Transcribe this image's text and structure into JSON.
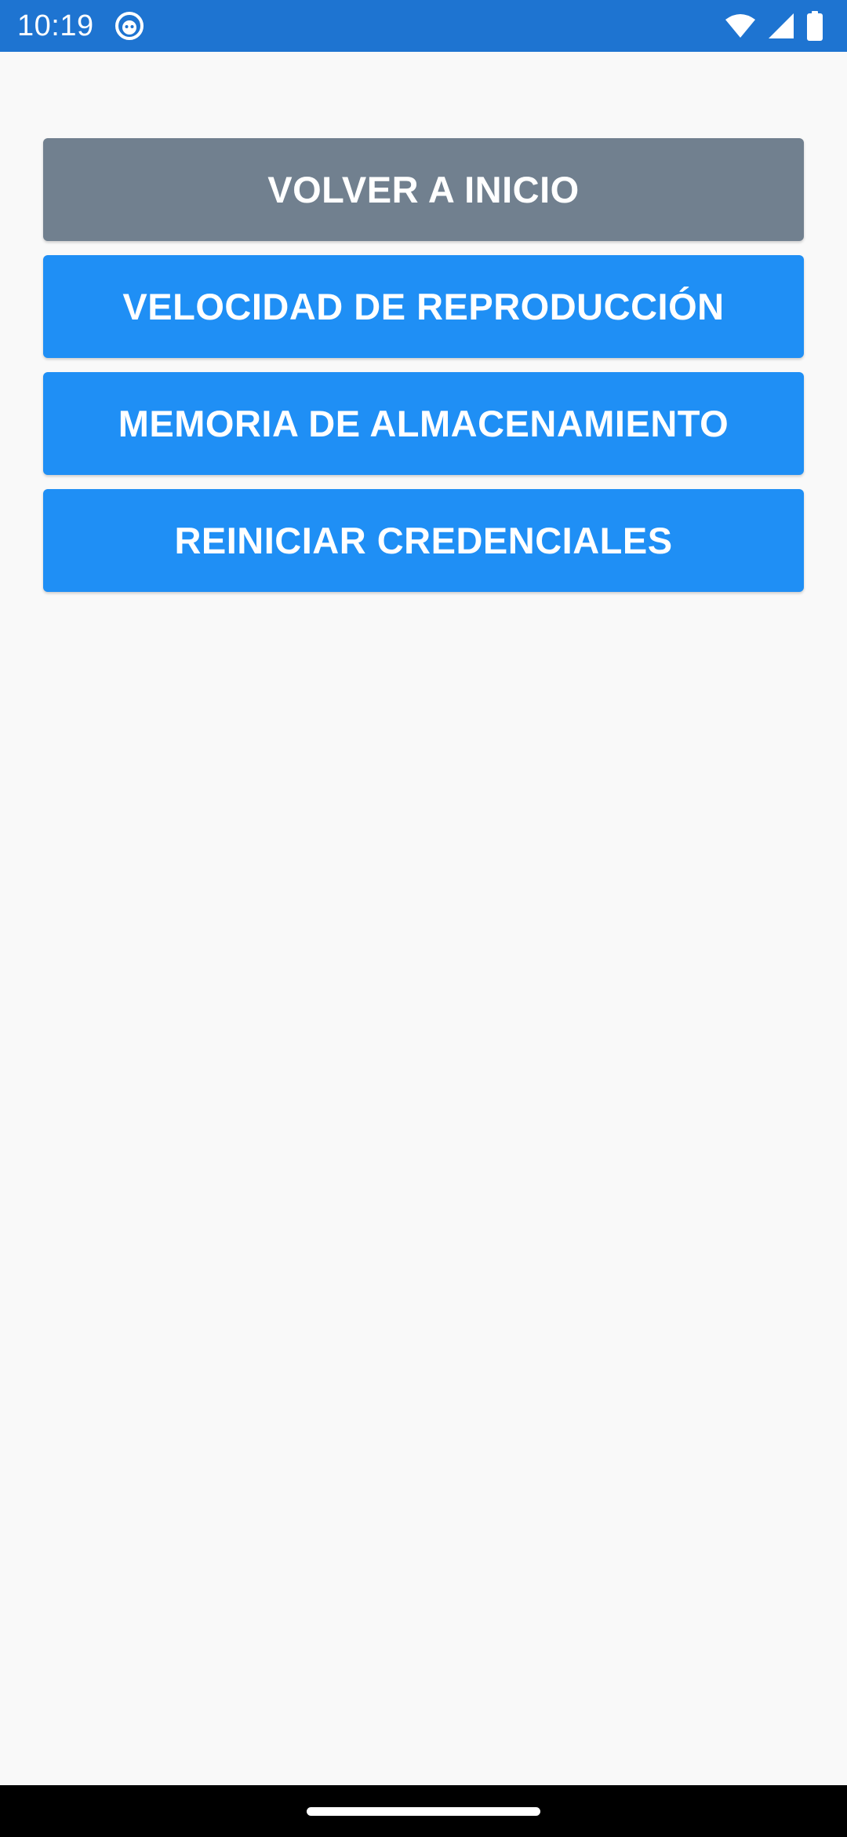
{
  "status_bar": {
    "time": "10:19",
    "icons": [
      "app-notification-icon",
      "wifi-icon",
      "signal-icon",
      "battery-icon"
    ],
    "background": "#1e74d1"
  },
  "buttons": [
    {
      "label": "VOLVER A INICIO",
      "color": "#71808f"
    },
    {
      "label": "VELOCIDAD DE REPRODUCCIÓN",
      "color": "#1f8ff5"
    },
    {
      "label": "MEMORIA DE ALMACENAMIENTO",
      "color": "#1f8ff5"
    },
    {
      "label": "REINICIAR CREDENCIALES",
      "color": "#1f8ff5"
    }
  ],
  "colors": {
    "page_background": "#f9f9f9",
    "nav_bar": "#000000"
  }
}
